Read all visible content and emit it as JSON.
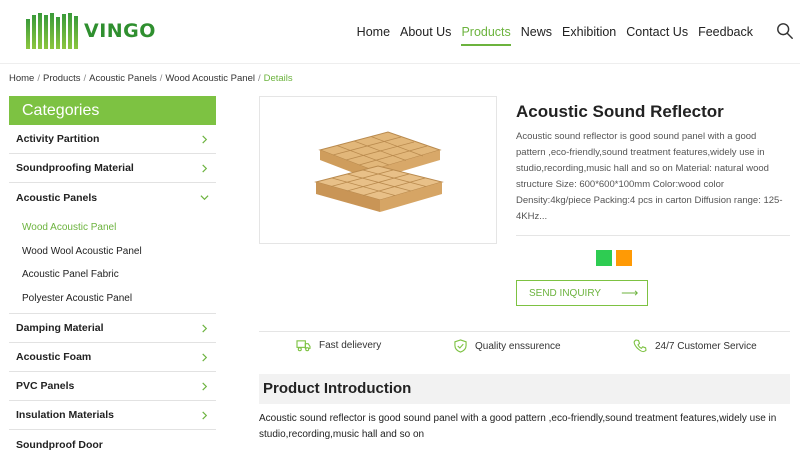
{
  "brand": {
    "name": "VINGO",
    "accent": "#7dc242"
  },
  "nav": {
    "items": [
      {
        "label": "Home"
      },
      {
        "label": "About Us"
      },
      {
        "label": "Products",
        "active": true
      },
      {
        "label": "News"
      },
      {
        "label": "Exhibition"
      },
      {
        "label": "Contact Us"
      },
      {
        "label": "Feedback"
      }
    ],
    "search_icon": "search-icon"
  },
  "breadcrumb": {
    "items": [
      "Home",
      "Products",
      "Acoustic Panels",
      "Wood Acoustic Panel"
    ],
    "current": "Details"
  },
  "sidebar": {
    "title": "Categories",
    "categories": [
      {
        "label": "Activity Partition"
      },
      {
        "label": "Soundproofing Material"
      },
      {
        "label": "Acoustic Panels",
        "expanded": true
      },
      {
        "label": "Damping Material"
      },
      {
        "label": "Acoustic Foam"
      },
      {
        "label": "PVC Panels"
      },
      {
        "label": "Insulation Materials"
      },
      {
        "label": "Soundproof Door"
      }
    ],
    "subitems": [
      {
        "label": "Wood Acoustic Panel",
        "active": true
      },
      {
        "label": "Wood Wool Acoustic Panel"
      },
      {
        "label": "Acoustic Panel Fabric"
      },
      {
        "label": "Polyester Acoustic Panel"
      }
    ]
  },
  "product": {
    "title": "Acoustic Sound Reflector",
    "description": "Acoustic sound reflector is good sound panel with a good pattern ,eco-friendly,sound treatment features,widely use in studio,recording,music hall and so on Material: natural wood structure Size: 600*600*100mm Color:wood color Density:4kg/piece Packing:4 pcs in carton Diffusion range: 125-4KHz...",
    "swatches": [
      "#2ecc52",
      "#ff9a05"
    ],
    "inquiry_label": "SEND INQUIRY"
  },
  "features": [
    {
      "label": "Fast delievery",
      "icon": "truck-icon"
    },
    {
      "label": "Quality enssurence",
      "icon": "shield-check-icon"
    },
    {
      "label": "24/7 Customer Service",
      "icon": "phone-icon"
    }
  ],
  "introduction": {
    "heading": "Product Introduction",
    "text": "Acoustic sound reflector is good sound panel with a good pattern ,eco-friendly,sound treatment features,widely use in studio,recording,music hall  and so on"
  }
}
